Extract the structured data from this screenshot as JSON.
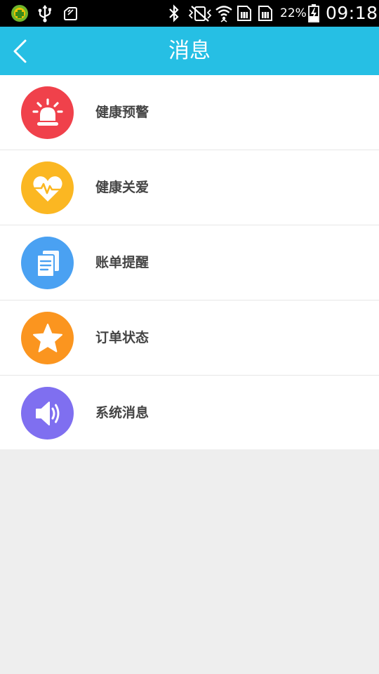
{
  "status_bar": {
    "battery_percent": "22%",
    "time": "09:18",
    "icons": [
      "app-notification-icon",
      "usb-icon",
      "screenshot-icon",
      "bluetooth-icon",
      "vibrate-icon",
      "wifi-icon",
      "sim-card-icon",
      "sim-card-icon",
      "battery-charging-icon"
    ]
  },
  "header": {
    "title": "消息",
    "back_icon": "back-arrow-icon"
  },
  "colors": {
    "header_bg": "#26bfe4",
    "health_alert": "#f0414b",
    "health_care": "#fbb722",
    "bill_reminder": "#4aa1f2",
    "order_status": "#fb951f",
    "system_message": "#7f6ff0"
  },
  "messages": [
    {
      "label": "健康预警",
      "icon": "alarm-siren-icon"
    },
    {
      "label": "健康关爱",
      "icon": "heart-pulse-icon"
    },
    {
      "label": "账单提醒",
      "icon": "document-copy-icon"
    },
    {
      "label": "订单状态",
      "icon": "star-icon"
    },
    {
      "label": "系统消息",
      "icon": "speaker-volume-icon"
    }
  ]
}
